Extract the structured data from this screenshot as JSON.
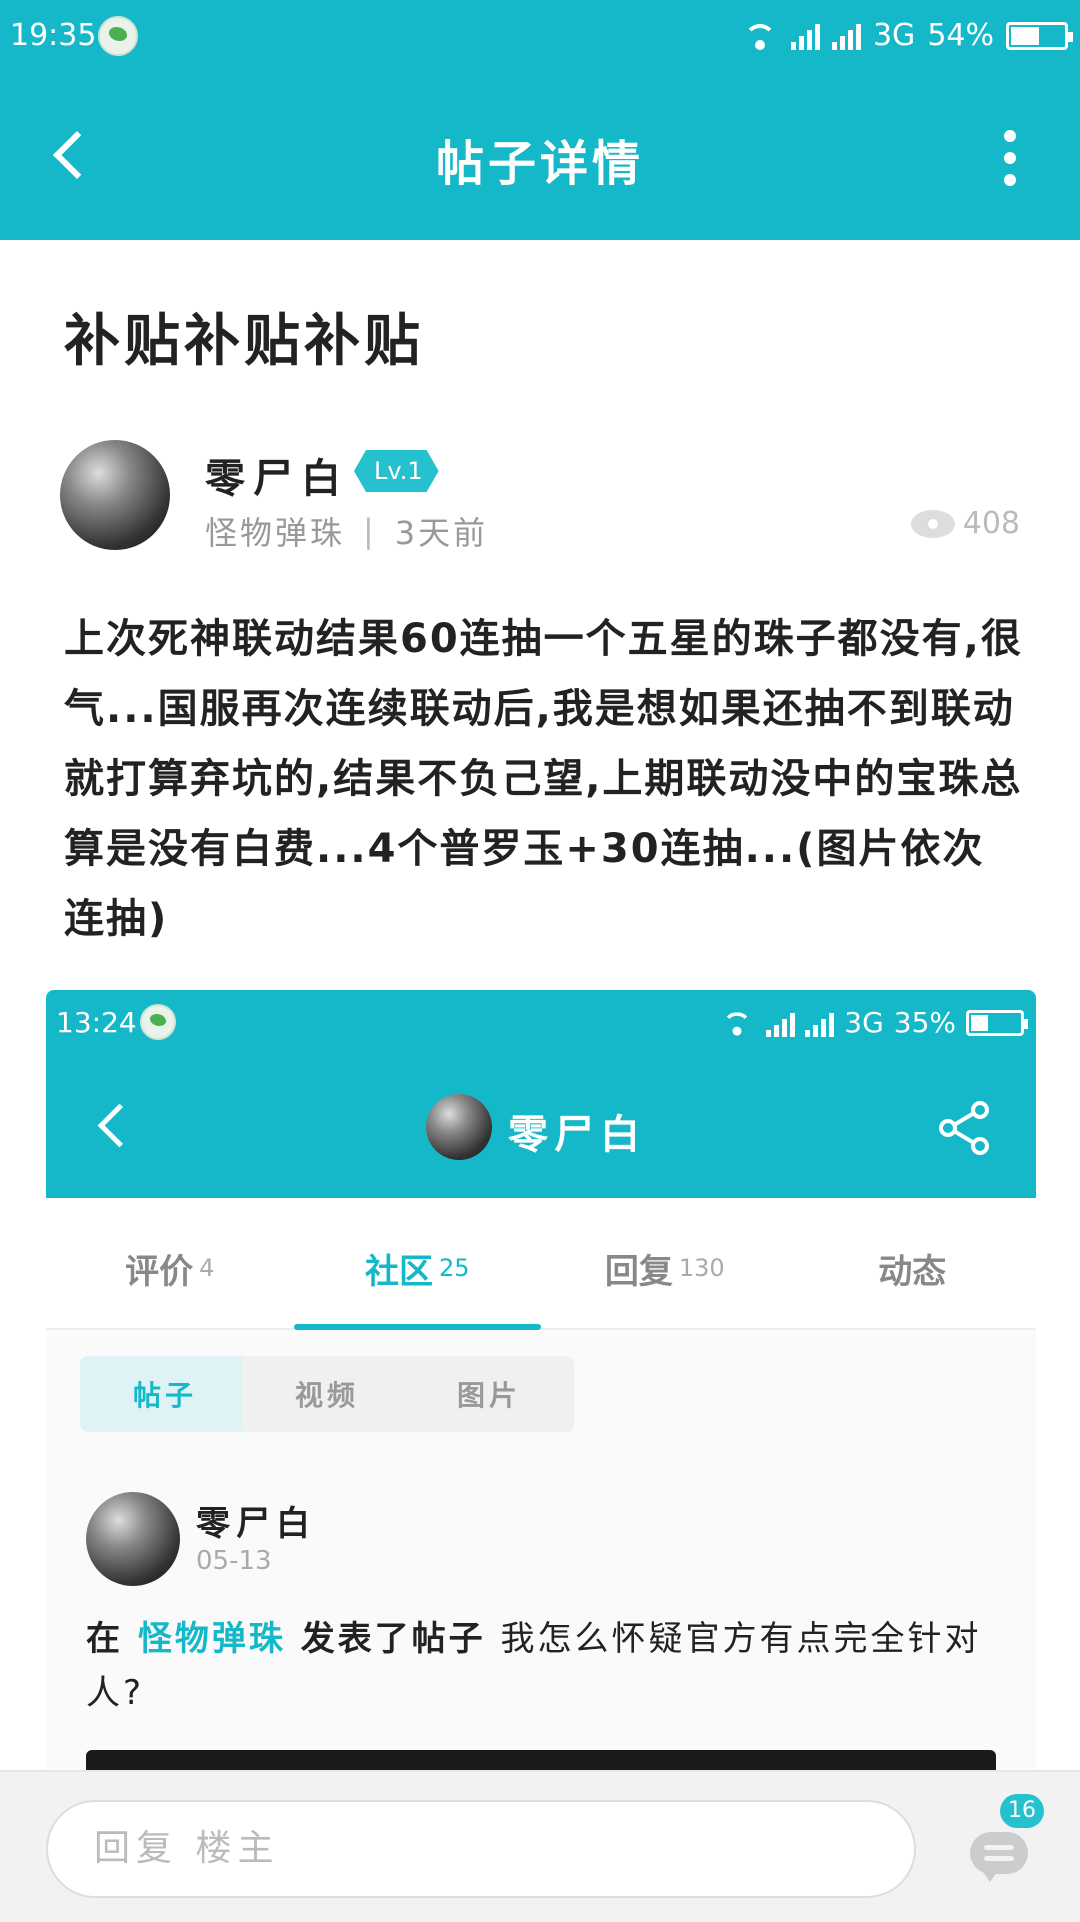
{
  "status_bar": {
    "time": "19:35",
    "network": "3G",
    "battery": "54%",
    "battery_level": 0.54
  },
  "nav": {
    "title": "帖子详情"
  },
  "post": {
    "title": "补贴补贴补贴",
    "author": {
      "name": "零尸白",
      "level": "Lv.1",
      "section": "怪物弹珠",
      "separator": "|",
      "time_ago": "3天前"
    },
    "views": "408",
    "body": "上次死神联动结果60连抽一个五星的珠子都没有,很气...国服再次连续联动后,我是想如果还抽不到联动就打算弃坑的,结果不负己望,上期联动没中的宝珠总算是没有白费...4个普罗玉+30连抽...(图片依次连抽)"
  },
  "embedded_screenshot": {
    "status_bar": {
      "time": "13:24",
      "network": "3G",
      "battery": "35%",
      "battery_level": 0.35
    },
    "nav": {
      "title": "零尸白"
    },
    "tabs": [
      {
        "label": "评价",
        "count": "4",
        "active": false
      },
      {
        "label": "社区",
        "count": "25",
        "active": true
      },
      {
        "label": "回复",
        "count": "130",
        "active": false
      },
      {
        "label": "动态",
        "count": "",
        "active": false
      }
    ],
    "chips": [
      {
        "label": "帖子",
        "active": true
      },
      {
        "label": "视频",
        "active": false
      },
      {
        "label": "图片",
        "active": false
      }
    ],
    "post": {
      "author": "零尸白",
      "date": "05-13",
      "prefix": "在",
      "section": "怪物弹珠",
      "action": "发表了帖子",
      "text": "我怎么怀疑官方有点完全针对人?"
    }
  },
  "reply_bar": {
    "placeholder": "回复 楼主",
    "comment_count": "16"
  },
  "colors": {
    "accent": "#15b8c8",
    "badge": "#26c1cf"
  }
}
